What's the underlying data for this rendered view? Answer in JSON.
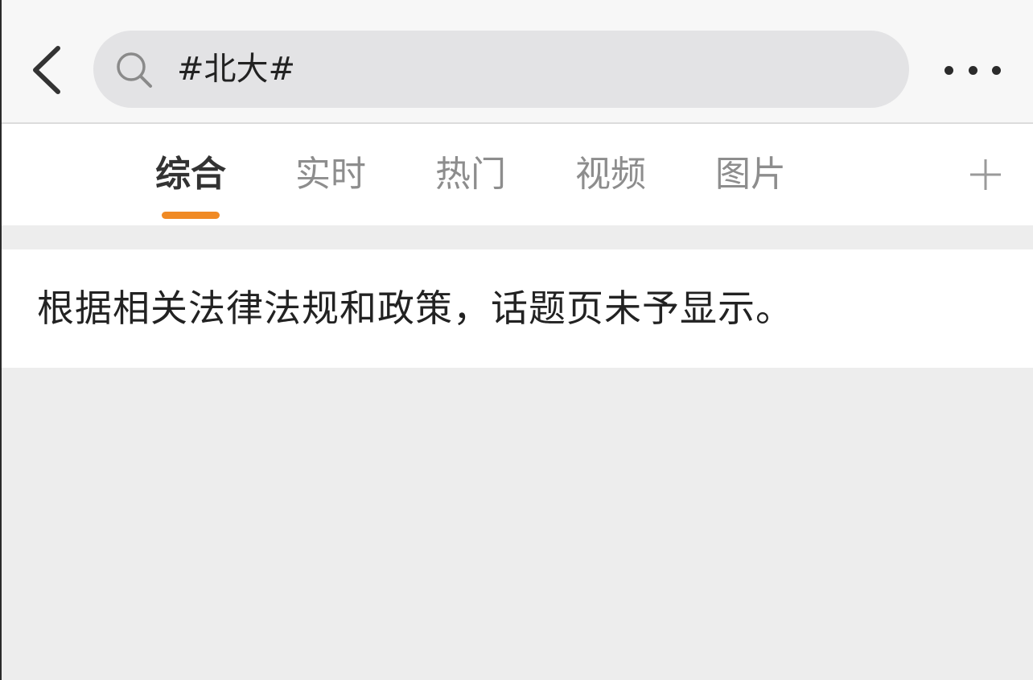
{
  "header": {
    "back_icon": "chevron-left-icon",
    "search": {
      "icon": "search-icon",
      "value": "#北大#"
    },
    "more_icon": "more-horizontal-icon"
  },
  "tabs": [
    {
      "label": "综合",
      "active": true
    },
    {
      "label": "实时",
      "active": false
    },
    {
      "label": "热门",
      "active": false
    },
    {
      "label": "视频",
      "active": false
    },
    {
      "label": "图片",
      "active": false
    }
  ],
  "tab_add_icon": "plus-icon",
  "notice": {
    "text": "根据相关法律法规和政策，话题页未予显示。"
  },
  "colors": {
    "accent": "#f08a24",
    "background": "#ededed",
    "search_bg": "#e3e3e5",
    "active_tab_text": "#333333",
    "inactive_tab_text": "#8d8d8d"
  }
}
